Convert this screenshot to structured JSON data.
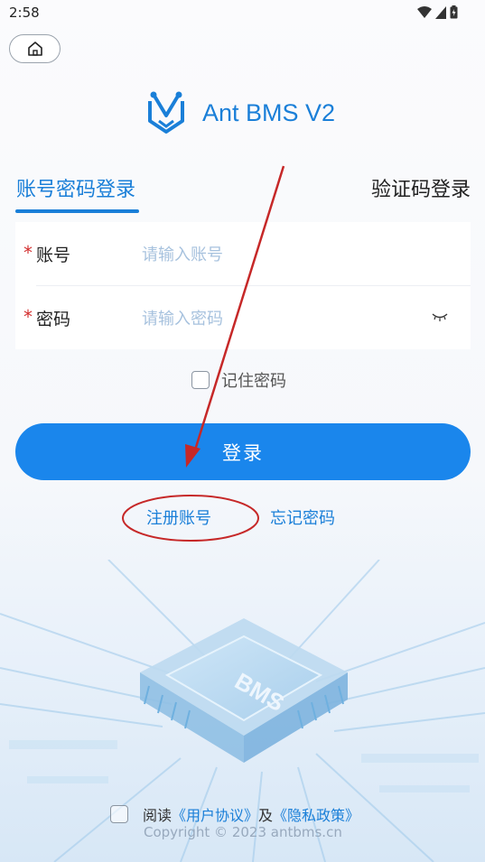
{
  "status_bar": {
    "time": "2:58"
  },
  "header": {
    "home_icon": "home-icon",
    "brand_title": "Ant BMS V2"
  },
  "tabs": {
    "account_login": "账号密码登录",
    "code_login": "验证码登录"
  },
  "form": {
    "account": {
      "required_mark": "*",
      "label": "账号",
      "placeholder": "请输入账号"
    },
    "password": {
      "required_mark": "*",
      "label": "密码",
      "placeholder": "请输入密码",
      "toggle_icon": "eye-closed-icon"
    }
  },
  "remember": {
    "label": "记住密码"
  },
  "login_button": {
    "label": "登录"
  },
  "links": {
    "register": "注册账号",
    "forgot": "忘记密码"
  },
  "agreement": {
    "prefix": "阅读",
    "user_agreement": "《用户协议》",
    "and": "及",
    "privacy_policy": "《隐私政策》"
  },
  "footer": {
    "copyright": "Copyright © 2023 antbms.cn"
  },
  "illustration": {
    "chip_label": "BMS"
  },
  "colors": {
    "accent": "#1a86ec",
    "link": "#1a7fd8",
    "required": "#d32f2f",
    "annotation": "#c62828"
  }
}
